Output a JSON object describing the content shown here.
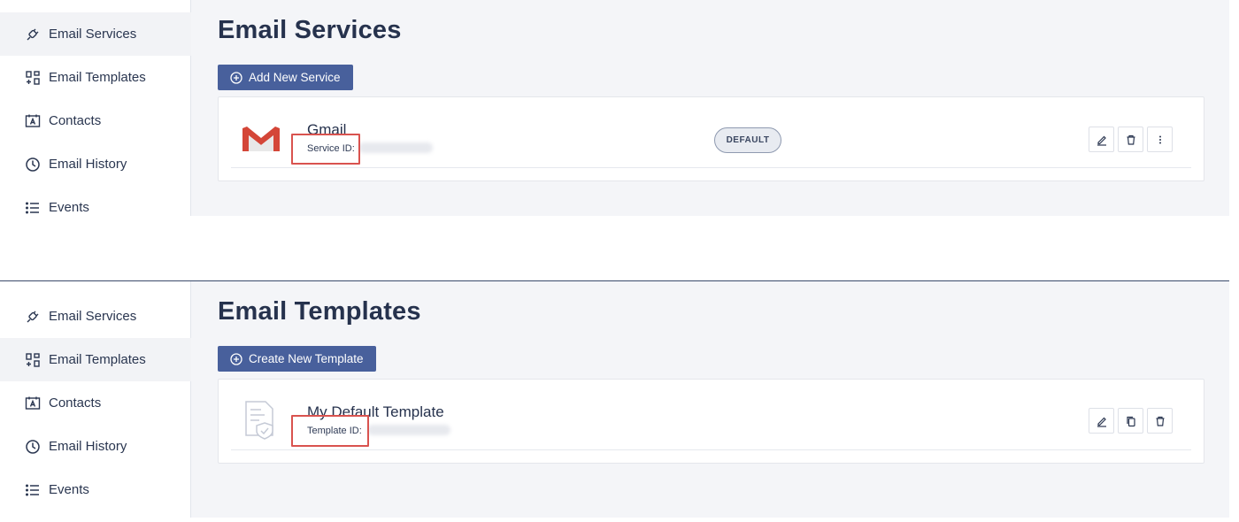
{
  "screens": [
    {
      "sidebar": {
        "items": [
          {
            "label": "Email Services",
            "icon": "plug-icon",
            "active": true
          },
          {
            "label": "Email Templates",
            "icon": "templates-icon",
            "active": false
          },
          {
            "label": "Contacts",
            "icon": "contacts-icon",
            "active": false
          },
          {
            "label": "Email History",
            "icon": "history-icon",
            "active": false
          },
          {
            "label": "Events",
            "icon": "list-icon",
            "active": false
          }
        ]
      },
      "title": "Email Services",
      "primary_button": "Add New Service",
      "card": {
        "name": "Gmail",
        "id_label": "Service ID:",
        "badge": "DEFAULT",
        "actions": [
          "edit-icon",
          "trash-icon",
          "more-vertical-icon"
        ]
      }
    },
    {
      "sidebar": {
        "items": [
          {
            "label": "Email Services",
            "icon": "plug-icon",
            "active": false
          },
          {
            "label": "Email Templates",
            "icon": "templates-icon",
            "active": true
          },
          {
            "label": "Contacts",
            "icon": "contacts-icon",
            "active": false
          },
          {
            "label": "Email History",
            "icon": "history-icon",
            "active": false
          },
          {
            "label": "Events",
            "icon": "list-icon",
            "active": false
          }
        ]
      },
      "title": "Email Templates",
      "primary_button": "Create New Template",
      "card": {
        "name": "My Default Template",
        "id_label": "Template ID:",
        "actions": [
          "edit-icon",
          "copy-icon",
          "trash-icon"
        ]
      }
    }
  ],
  "colors": {
    "primary": "#48609c",
    "highlight": "#d9534f",
    "gmail_red": "#d44638"
  }
}
